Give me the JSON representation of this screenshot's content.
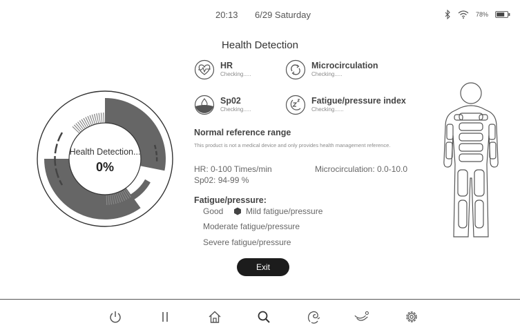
{
  "status": {
    "time": "20:13",
    "date": "6/29 Saturday",
    "battery": "78%",
    "icons": [
      "bluetooth-icon",
      "wifi-icon",
      "battery-icon"
    ]
  },
  "title": "Health Detection",
  "ring": {
    "label": "Health Detection...",
    "percent": "0%"
  },
  "metrics": [
    {
      "name": "HR",
      "status": "Checking.....",
      "icon": "heartbeat-icon"
    },
    {
      "name": "Microcirculation",
      "status": "Checking.....",
      "icon": "refresh-circle-icon"
    },
    {
      "name": "Sp02",
      "status": "Checking.....",
      "icon": "droplet-icon"
    },
    {
      "name": "Fatigue/pressure index",
      "status": "Checking......",
      "icon": "sleep-icon"
    }
  ],
  "reference": {
    "title": "Normal reference range",
    "disclaimer": "This product is not a medical device and only provides health management reference.",
    "hr": "HR: 0-100 Times/min",
    "micro": "Microcirculation: 0.0-10.0",
    "spo2": "Sp02: 94-99 %"
  },
  "fatigue": {
    "title": "Fatigue/pressure:",
    "good": "Good",
    "mild": "Mild fatigue/pressure",
    "moderate": "Moderate fatigue/pressure",
    "severe": "Severe fatigue/pressure"
  },
  "exit_label": "Exit",
  "nav": [
    "power-icon",
    "pause-icon",
    "home-icon",
    "search-icon",
    "massage-hand-icon",
    "recline-icon",
    "settings-gear-icon"
  ],
  "colors": {
    "accent": "#4a4a4a",
    "button_bg": "#1c1c1c",
    "text": "#3a3a3a"
  }
}
